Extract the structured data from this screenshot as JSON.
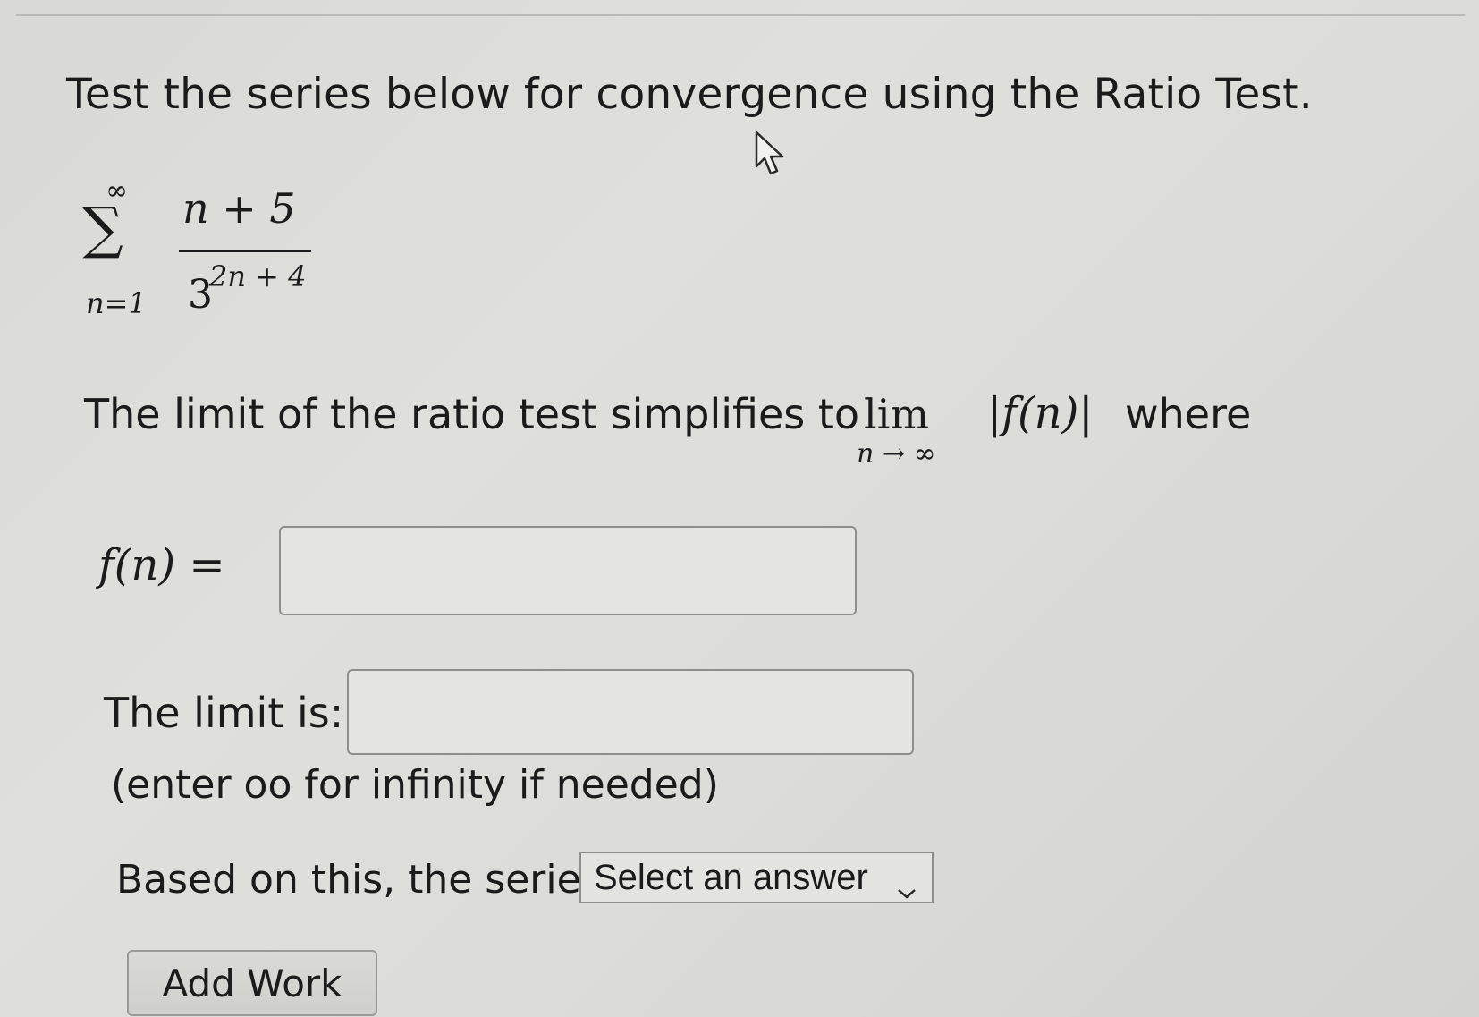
{
  "question": {
    "prompt": "Test the series below for convergence using the Ratio Test."
  },
  "series": {
    "upper_limit": "∞",
    "sigma": "∑",
    "lower_limit": "n=1",
    "numerator": "n + 5",
    "denominator_base": "3",
    "denominator_exponent": "2n + 4"
  },
  "ratio_statement": {
    "text": "The limit of the ratio test simplifies to",
    "lim": "lim",
    "lim_subscript": "n → ∞",
    "expression": "|f(n)|",
    "where": "where"
  },
  "fn_field": {
    "label": "f(n) =",
    "value": ""
  },
  "limit_field": {
    "label": "The limit is:",
    "value": "",
    "hint": "(enter oo for infinity if needed)"
  },
  "conclusion": {
    "label": "Based on this, the series",
    "select_value": "Select an answer"
  },
  "add_work_button": {
    "label": "Add Work"
  }
}
